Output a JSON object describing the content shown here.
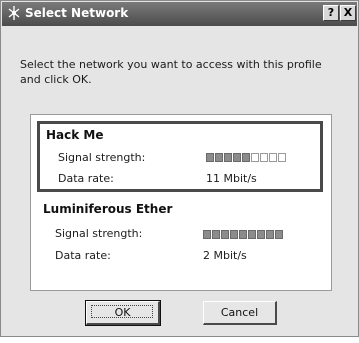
{
  "window": {
    "title": "Select Network",
    "help_label": "?",
    "close_label": "X"
  },
  "instructions": "Select the network you want to access with this profile and click OK.",
  "networks": [
    {
      "name": "Hack Me",
      "signal_label": "Signal strength:",
      "signal_level": 0.55,
      "rate_label": "Data rate:",
      "rate_value": "11 Mbit/s",
      "selected": true
    },
    {
      "name": "Luminiferous Ether",
      "signal_label": "Signal strength:",
      "signal_level": 1.0,
      "rate_label": "Data rate:",
      "rate_value": "2 Mbit/s",
      "selected": false
    }
  ],
  "buttons": {
    "ok_label": "OK",
    "cancel_label": "Cancel"
  },
  "colors": {
    "titlebar": "#4c4c4c",
    "dialog_bg": "#e5e5e5",
    "list_bg": "#ffffff",
    "selection_border": "#4a4a4a",
    "meter_on": "#8c8c8c"
  },
  "icons": {
    "title": "wireless-network-icon"
  }
}
